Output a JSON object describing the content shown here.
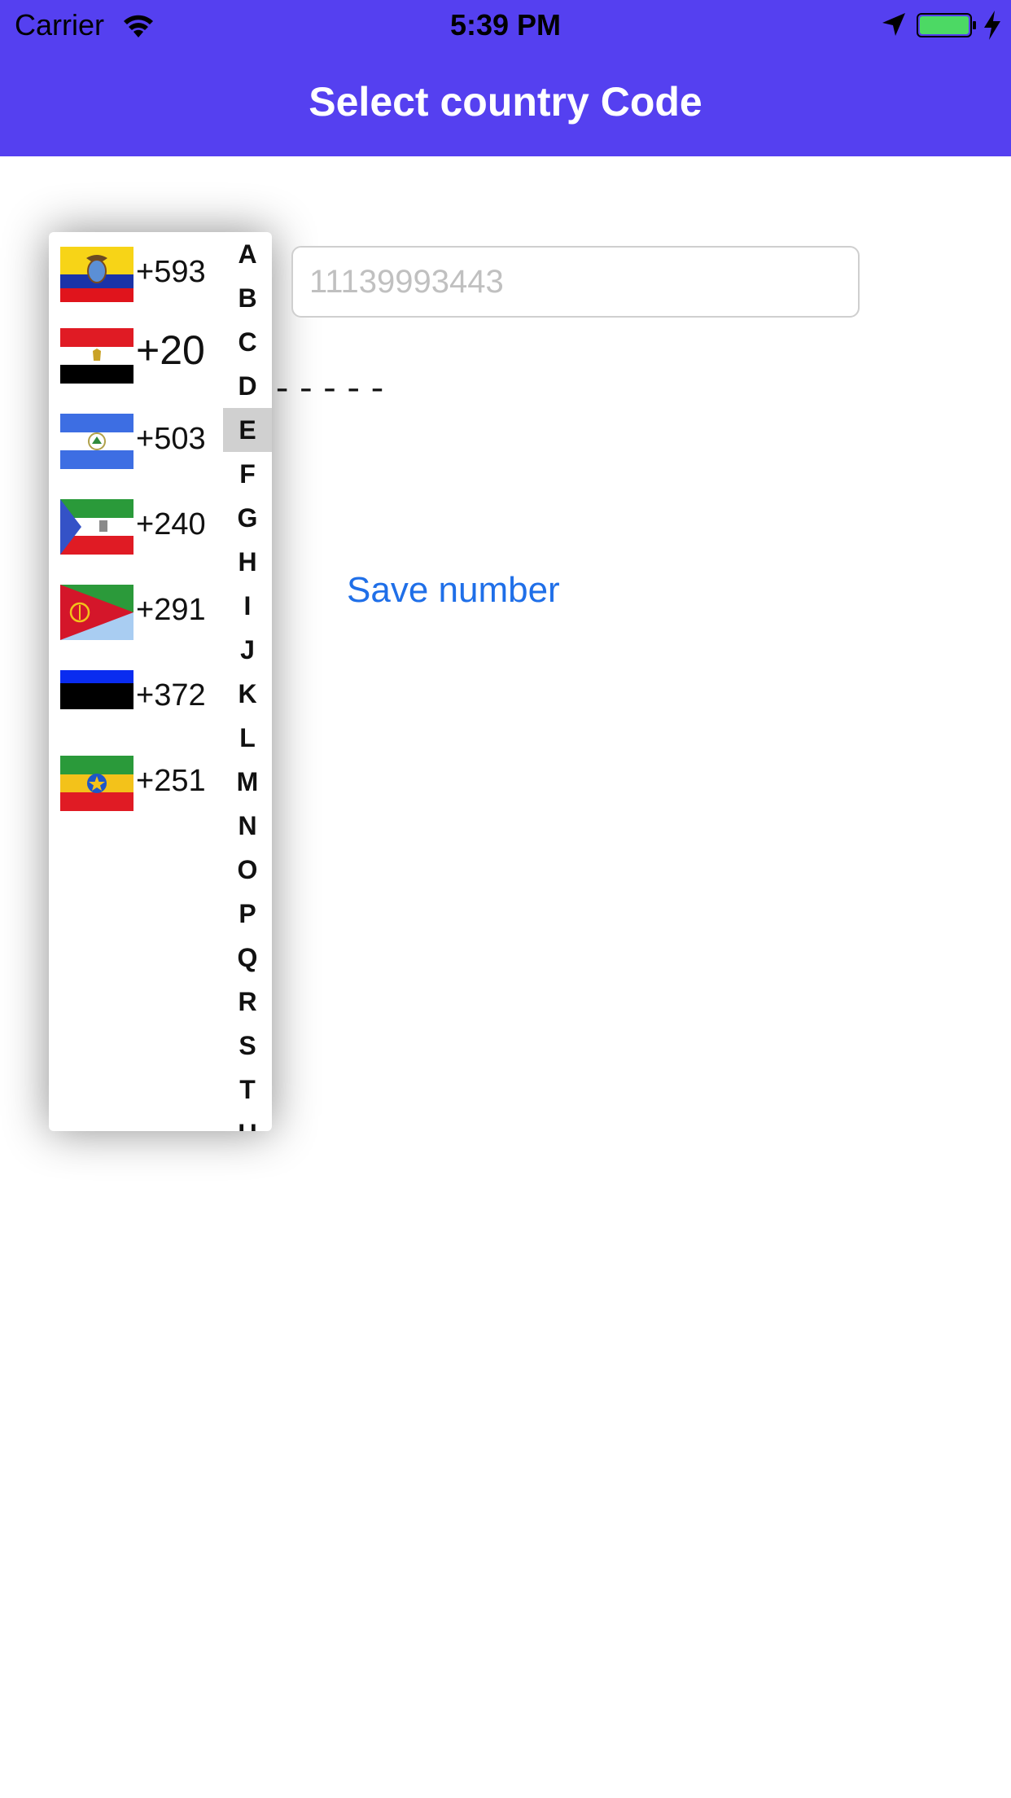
{
  "status_bar": {
    "carrier": "Carrier",
    "time": "5:39 PM",
    "icons": [
      "wifi-icon",
      "location-arrow-icon",
      "battery-icon",
      "charging-bolt-icon"
    ],
    "battery_color": "#4cd964"
  },
  "header": {
    "title": "Select country Code",
    "background": "#5540f0"
  },
  "country_list": [
    {
      "code": "+593",
      "flag": "ecuador-flag-icon"
    },
    {
      "code": "+20",
      "flag": "egypt-flag-icon"
    },
    {
      "code": "+503",
      "flag": "el-salvador-flag-icon"
    },
    {
      "code": "+240",
      "flag": "equatorial-guinea-flag-icon"
    },
    {
      "code": "+291",
      "flag": "eritrea-flag-icon"
    },
    {
      "code": "+372",
      "flag": "estonia-flag-icon"
    },
    {
      "code": "+251",
      "flag": "ethiopia-flag-icon"
    }
  ],
  "index_letters": [
    "A",
    "B",
    "C",
    "D",
    "E",
    "F",
    "G",
    "H",
    "I",
    "J",
    "K",
    "L",
    "M",
    "N",
    "O",
    "P",
    "Q",
    "R",
    "S",
    "T",
    "U"
  ],
  "selected_index_letter": "E",
  "phone_field": {
    "value": "",
    "placeholder": "11139993443"
  },
  "selected_code_display": "-----",
  "save_button_label": "Save number",
  "accent_color": "#1f6fe8"
}
